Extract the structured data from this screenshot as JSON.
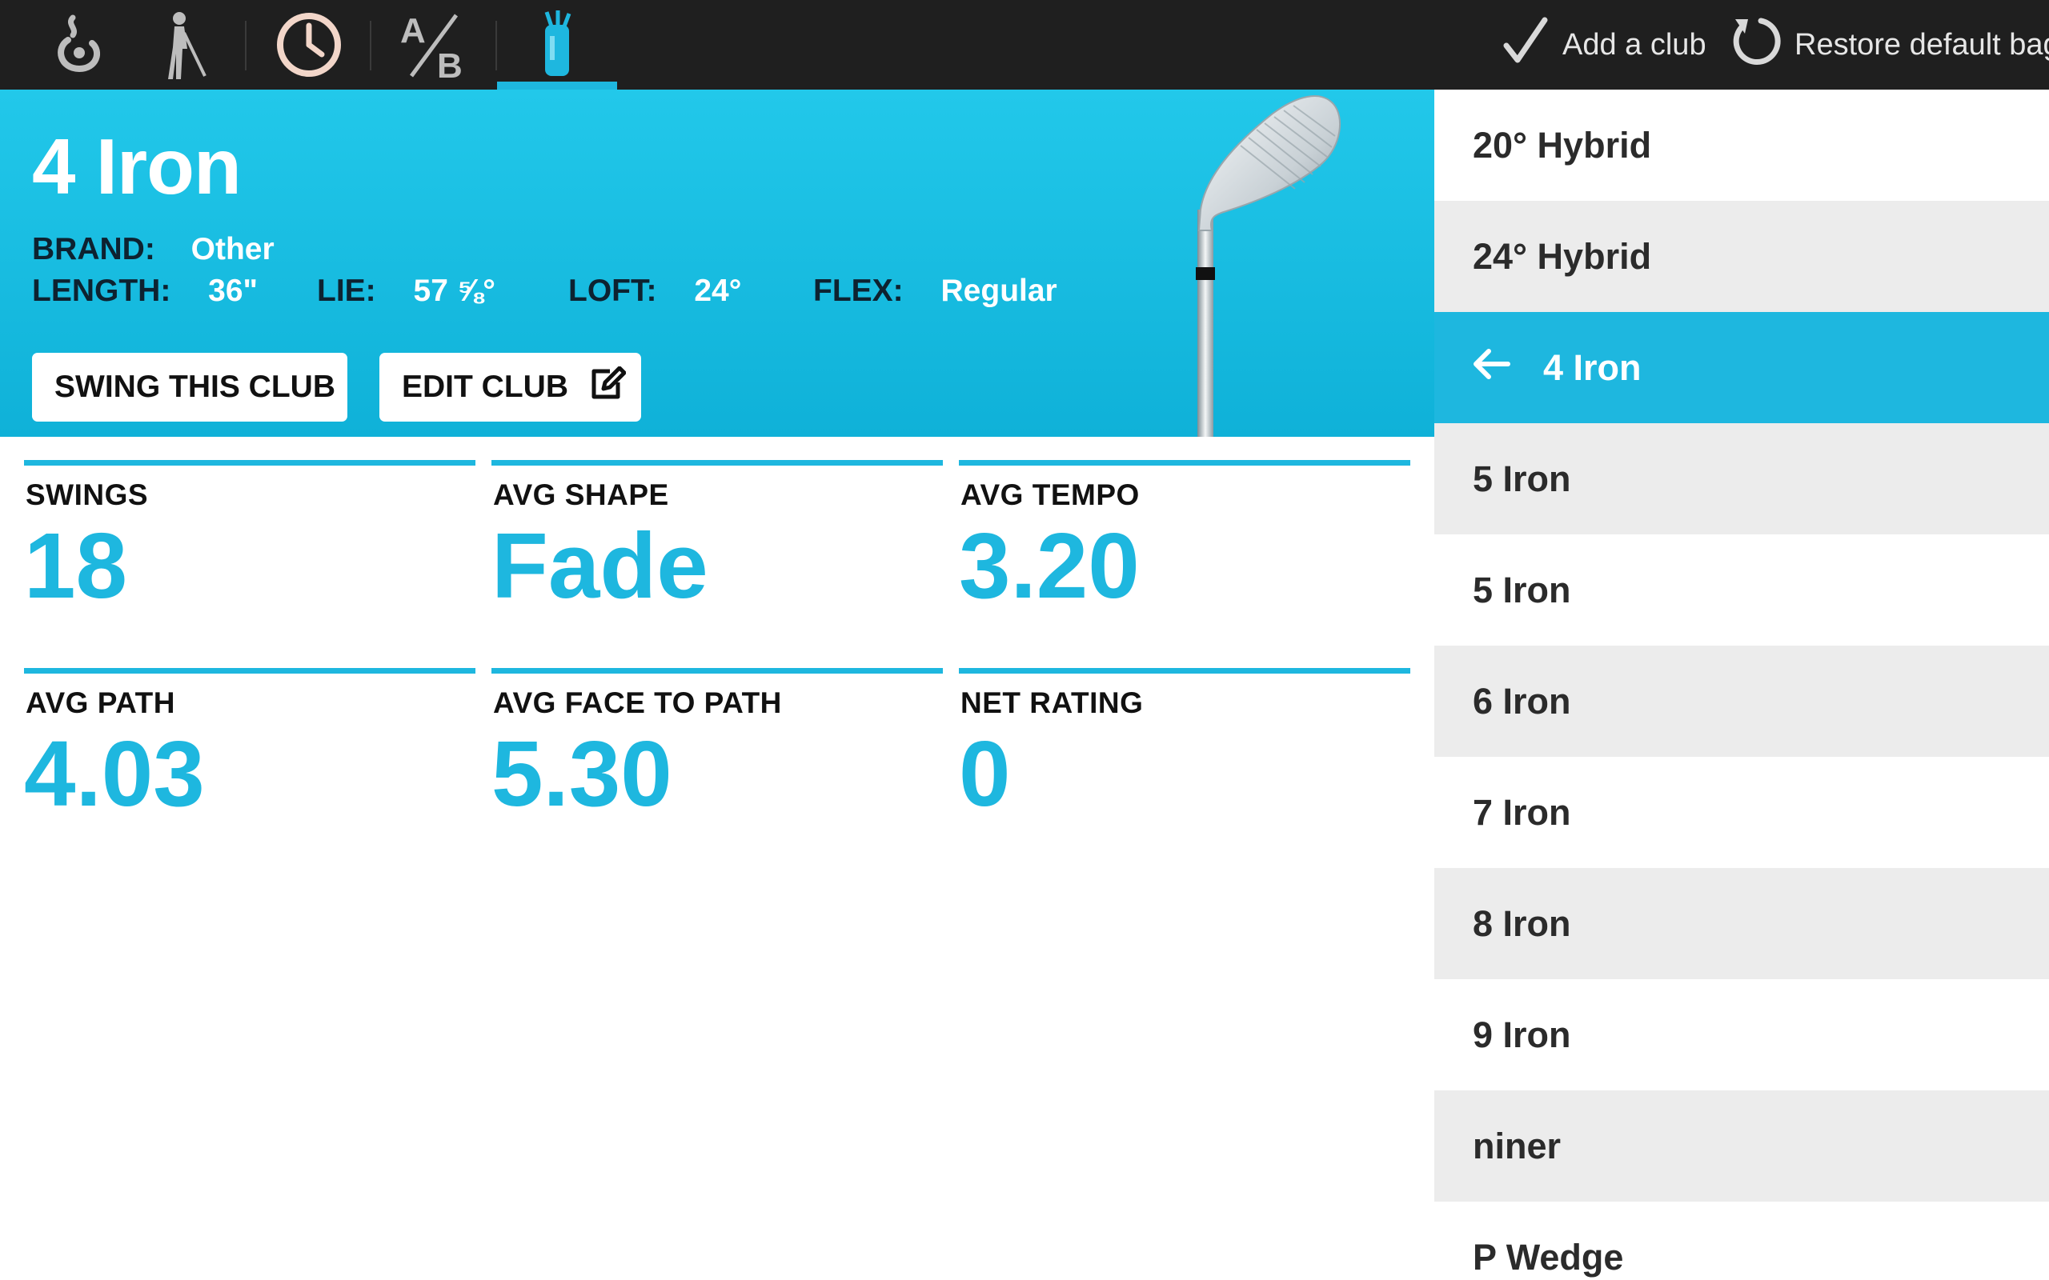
{
  "toolbar": {
    "tabs": [
      {
        "icon": "swing-hook-icon",
        "active": false
      },
      {
        "icon": "golfer-icon",
        "active": false
      },
      {
        "icon": "clock-icon",
        "active": false
      },
      {
        "icon": "ab-compare-icon",
        "active": false,
        "text_a": "A",
        "text_b": "B"
      },
      {
        "icon": "golf-bag-icon",
        "active": true
      }
    ],
    "add_club_label": "Add a club",
    "restore_label": "Restore default bag"
  },
  "club": {
    "name": "4 Iron",
    "brand_label": "BRAND:",
    "brand": "Other",
    "length_label": "LENGTH:",
    "length": "36\"",
    "lie_label": "LIE:",
    "lie": "57 ⅝°",
    "loft_label": "LOFT:",
    "loft": "24°",
    "flex_label": "FLEX:",
    "flex": "Regular",
    "swing_button": "SWING THIS CLUB",
    "edit_button": "EDIT CLUB"
  },
  "stats": [
    {
      "label": "SWINGS",
      "value": "18"
    },
    {
      "label": "AVG SHAPE",
      "value": "Fade"
    },
    {
      "label": "AVG TEMPO",
      "value": "3.20"
    },
    {
      "label": "AVG PATH",
      "value": "4.03"
    },
    {
      "label": "AVG FACE TO PATH",
      "value": "5.30"
    },
    {
      "label": "NET RATING",
      "value": "0"
    }
  ],
  "club_list": [
    {
      "label": "20° Hybrid",
      "selected": false
    },
    {
      "label": "24° Hybrid",
      "selected": false
    },
    {
      "label": "4 Iron",
      "selected": true
    },
    {
      "label": "5 Iron",
      "selected": false
    },
    {
      "label": "5 Iron",
      "selected": false
    },
    {
      "label": "6 Iron",
      "selected": false
    },
    {
      "label": "7 Iron",
      "selected": false
    },
    {
      "label": "8 Iron",
      "selected": false
    },
    {
      "label": "9 Iron",
      "selected": false
    },
    {
      "label": "niner",
      "selected": false
    },
    {
      "label": "P Wedge",
      "selected": false
    }
  ],
  "colors": {
    "accent": "#1eb7df",
    "toolbar_bg": "#1f1f1f",
    "list_alt_bg": "#ececec"
  }
}
